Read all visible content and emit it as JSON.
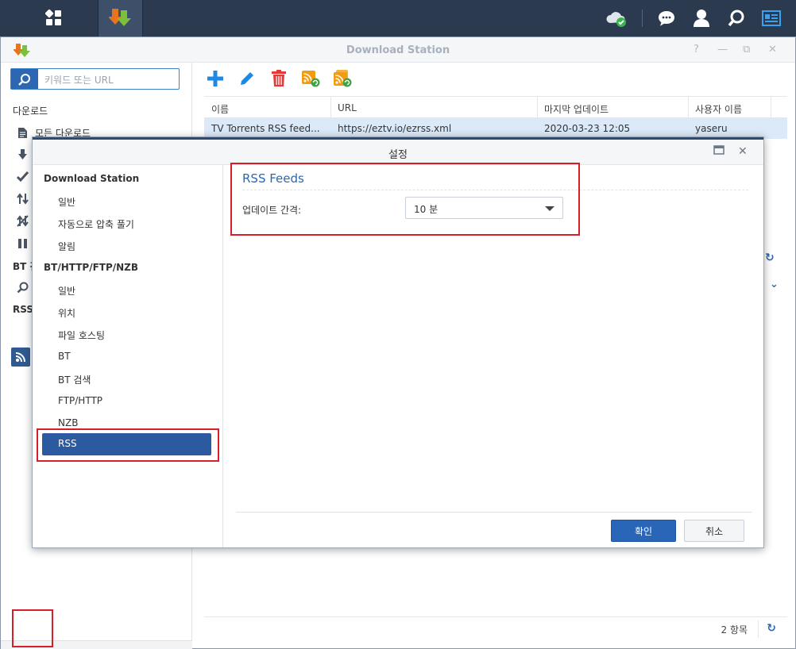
{
  "window": {
    "title": "Download Station",
    "help": "?",
    "minimize": "—",
    "restore": "⧉",
    "close": "✕"
  },
  "sidebar": {
    "search_placeholder": "키워드 또는 URL",
    "downloads_header": "다운로드",
    "all_downloads": "모든 다운로드",
    "bt_header": "BT 검",
    "rss_header": "RSS"
  },
  "table": {
    "columns": [
      "이름",
      "URL",
      "마지막 업데이트",
      "사용자 이름"
    ],
    "rows": [
      {
        "name": "TV Torrents RSS feed...",
        "url": "https://eztv.io/ezrss.xml",
        "updated": "2020-03-23 12:05",
        "user": "yaseru"
      }
    ]
  },
  "footer": {
    "count": "2 항목"
  },
  "modal": {
    "title": "설정",
    "nav": {
      "group1": "Download Station",
      "group1_items": [
        "일반",
        "자동으로 압축 풀기",
        "알림"
      ],
      "group2": "BT/HTTP/FTP/NZB",
      "group2_items": [
        "일반",
        "위치",
        "파일 호스팅",
        "BT",
        "BT 검색",
        "FTP/HTTP",
        "NZB"
      ],
      "selected": "RSS"
    },
    "section_title": "RSS Feeds",
    "field_label": "업데이트 간격:",
    "field_value": "10 분",
    "ok": "확인",
    "cancel": "취소"
  },
  "colors": {
    "taskbar": "#2b3a4f",
    "accent": "#2d67b2",
    "highlight": "#d81e2a",
    "selected_nav": "#2c5aa0"
  }
}
